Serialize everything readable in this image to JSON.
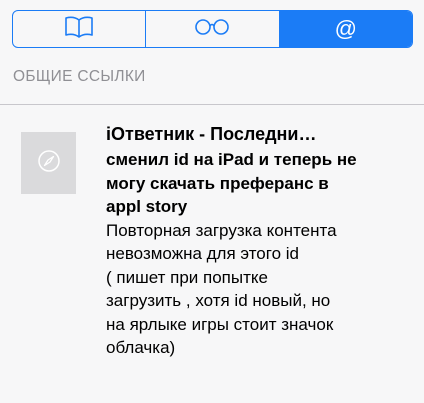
{
  "tabs": [
    {
      "name": "bookmarks",
      "icon": "book-icon",
      "active": false
    },
    {
      "name": "reading-list",
      "icon": "glasses-icon",
      "active": false
    },
    {
      "name": "shared-links",
      "icon": "at-sign-icon",
      "label": "@",
      "active": true
    }
  ],
  "colors": {
    "accent": "#1b7cf6",
    "header_text": "#8f8f94",
    "thumbnail": "#dadadc"
  },
  "section": {
    "header": "ОБЩИЕ ССЫЛКИ"
  },
  "shared_link": {
    "thumbnail_icon": "compass-icon",
    "title": "iОтветник - Последни…",
    "subtitle": "сменил id на iPad и теперь не\nмогу скачать преферанс в\nappl story",
    "body": "Повторная загрузка контента\nневозможна для этого id\n ( пишет при попытке\nзагрузить , хотя id новый, но\nна ярлыке игры стоит значок\nоблачка)"
  }
}
